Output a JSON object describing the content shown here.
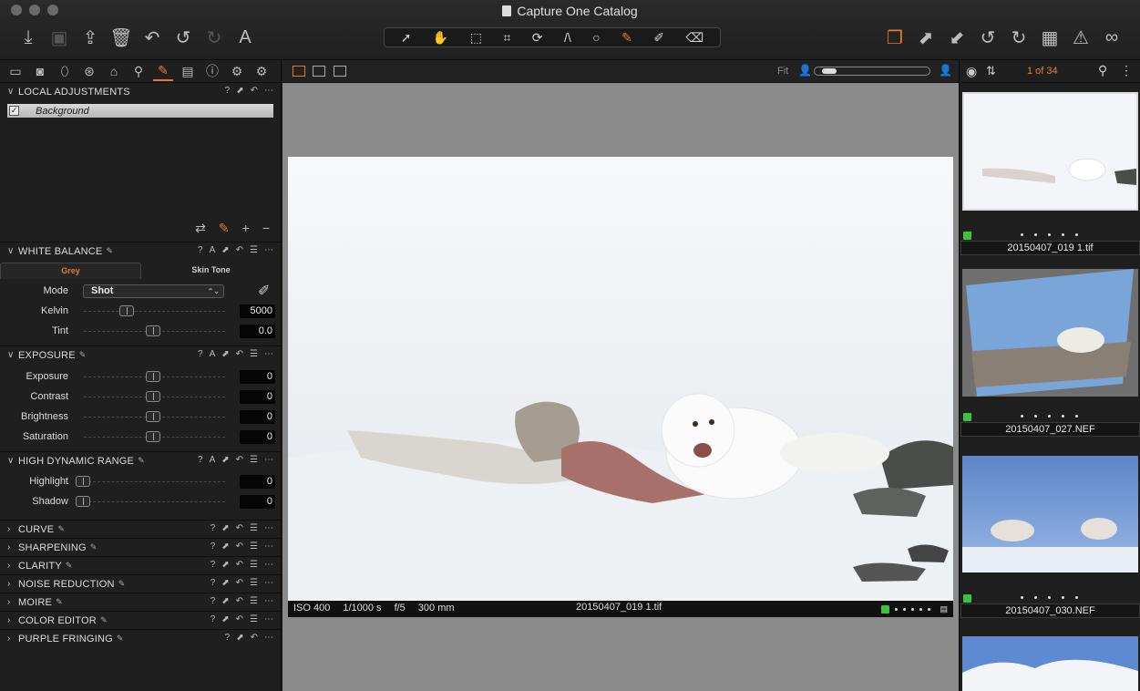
{
  "window": {
    "title": "Capture One Catalog"
  },
  "toolbar": {
    "left_icons": [
      "import-icon",
      "camera-icon",
      "export-icon",
      "delete-icon",
      "undo-history-icon",
      "undo-icon",
      "redo-icon",
      "text-icon"
    ],
    "cursor_tools": [
      "select-cursor-icon",
      "pan-hand-icon",
      "loupe-icon",
      "crop-icon",
      "rotate-icon",
      "keystone-icon",
      "spot-removal-icon",
      "brush-icon",
      "picker-icon",
      "eraser-icon"
    ],
    "right_icons": [
      "variants-icon",
      "expand-icon",
      "collapse-icon",
      "rotate-left-icon",
      "rotate-right-icon",
      "grid-icon",
      "warning-icon",
      "glasses-icon"
    ]
  },
  "left_panel": {
    "tool_tabs": [
      "library",
      "capture",
      "lens",
      "color",
      "exposure",
      "details",
      "adjustments",
      "metadata",
      "info",
      "settings",
      "batch"
    ],
    "local_adjustments": {
      "title": "LOCAL ADJUSTMENTS",
      "layers": [
        {
          "name": "Background",
          "checked": true
        }
      ]
    },
    "white_balance": {
      "title": "WHITE BALANCE",
      "tabs": [
        "Grey",
        "Skin Tone"
      ],
      "active_tab": "Grey",
      "mode_label": "Mode",
      "mode_value": "Shot",
      "kelvin_label": "Kelvin",
      "kelvin_value": "5000",
      "kelvin_level": 0.31,
      "tint_label": "Tint",
      "tint_value": "0.0",
      "tint_level": 0.5
    },
    "exposure": {
      "title": "EXPOSURE",
      "rows": [
        {
          "label": "Exposure",
          "value": "0",
          "level": 0.5
        },
        {
          "label": "Contrast",
          "value": "0",
          "level": 0.5
        },
        {
          "label": "Brightness",
          "value": "0",
          "level": 0.5
        },
        {
          "label": "Saturation",
          "value": "0",
          "level": 0.5
        }
      ]
    },
    "hdr": {
      "title": "HIGH DYNAMIC RANGE",
      "rows": [
        {
          "label": "Highlight",
          "value": "0",
          "level": 0
        },
        {
          "label": "Shadow",
          "value": "0",
          "level": 0
        }
      ]
    },
    "collapsed_tools": [
      "CURVE",
      "SHARPENING",
      "CLARITY",
      "NOISE REDUCTION",
      "MOIRE",
      "COLOR EDITOR",
      "PURPLE FRINGING"
    ]
  },
  "viewer": {
    "fit_label": "Fit",
    "iso": "ISO 400",
    "shutter": "1/1000 s",
    "aperture": "f/5",
    "focal": "300 mm",
    "filename": "20150407_019 1.tif",
    "color_tag": "#3ec23e"
  },
  "browser": {
    "count": "1 of 34",
    "thumbnails": [
      {
        "name": "20150407_019 1.tif",
        "tag": "#3ec23e",
        "selected": true
      },
      {
        "name": "20150407_027.NEF",
        "tag": "#3ec23e",
        "selected": false
      },
      {
        "name": "20150407_030.NEF",
        "tag": "#3ec23e",
        "selected": false
      }
    ]
  },
  "colors": {
    "accent": "#e87b2a",
    "green_tag": "#3ec23e"
  }
}
